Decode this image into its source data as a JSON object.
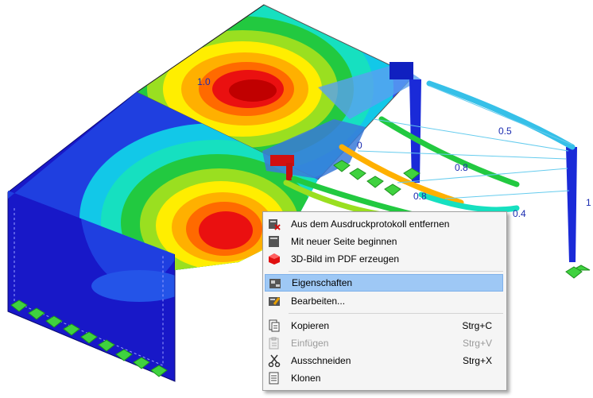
{
  "viewport": {
    "labels": [
      {
        "id": "label-top-slab",
        "text": "1.0"
      },
      {
        "id": "label-beam-upper",
        "text": "0.5"
      },
      {
        "id": "label-beam-mid",
        "text": "0.8"
      },
      {
        "id": "label-beam-left",
        "text": "0.8"
      },
      {
        "id": "label-beam-lower",
        "text": "0.4"
      },
      {
        "id": "label-center",
        "text": "0"
      },
      {
        "id": "label-right-edge",
        "text": "1"
      }
    ]
  },
  "context_menu": {
    "items": [
      {
        "label": "Aus dem Ausdruckprotokoll entfernen",
        "icon": "remove-from-report-icon",
        "shortcut": "",
        "enabled": true,
        "highlighted": false
      },
      {
        "label": "Mit neuer Seite beginnen",
        "icon": "new-page-icon",
        "shortcut": "",
        "enabled": true,
        "highlighted": false
      },
      {
        "label": "3D-Bild im PDF erzeugen",
        "icon": "3d-pdf-icon",
        "shortcut": "",
        "enabled": true,
        "highlighted": false
      },
      {
        "label": "Eigenschaften",
        "icon": "properties-icon",
        "shortcut": "",
        "enabled": true,
        "highlighted": true
      },
      {
        "label": "Bearbeiten...",
        "icon": "edit-icon",
        "shortcut": "",
        "enabled": true,
        "highlighted": false
      },
      {
        "label": "Kopieren",
        "icon": "copy-icon",
        "shortcut": "Strg+C",
        "enabled": true,
        "highlighted": false
      },
      {
        "label": "Einfügen",
        "icon": "paste-icon",
        "shortcut": "Strg+V",
        "enabled": false,
        "highlighted": false
      },
      {
        "label": "Ausschneiden",
        "icon": "cut-icon",
        "shortcut": "Strg+X",
        "enabled": true,
        "highlighted": false
      },
      {
        "label": "Klonen",
        "icon": "clone-icon",
        "shortcut": "",
        "enabled": true,
        "highlighted": false
      }
    ]
  }
}
